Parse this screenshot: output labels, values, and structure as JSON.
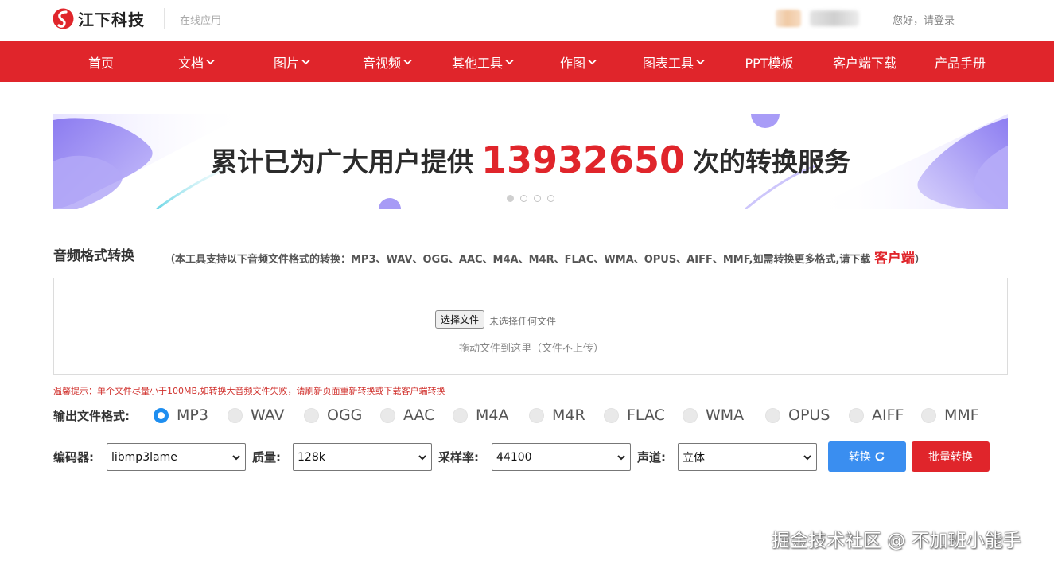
{
  "header": {
    "brand": "江下科技",
    "subtitle": "在线应用",
    "login": "您好，请登录"
  },
  "nav": {
    "items": [
      {
        "label": "首页",
        "dropdown": false
      },
      {
        "label": "文档",
        "dropdown": true
      },
      {
        "label": "图片",
        "dropdown": true
      },
      {
        "label": "音视频",
        "dropdown": true
      },
      {
        "label": "其他工具",
        "dropdown": true
      },
      {
        "label": "作图",
        "dropdown": true
      },
      {
        "label": "图表工具",
        "dropdown": true
      },
      {
        "label": "PPT模板",
        "dropdown": false
      },
      {
        "label": "客户端下载",
        "dropdown": false
      },
      {
        "label": "产品手册",
        "dropdown": false
      }
    ]
  },
  "banner": {
    "prefix": "累计已为广大用户提供",
    "count": "13932650",
    "suffix": "次的转换服务",
    "slides": 4,
    "active_slide": 1
  },
  "section": {
    "title": "音频格式转换",
    "note_prefix": "（本工具支持以下音频文件格式的转换：MP3、WAV、OGG、AAC、M4A、M4R、FLAC、WMA、OPUS、AIFF、MMF,如需转换更多格式,请下载",
    "client_link": "客户端",
    "note_suffix": "）"
  },
  "upload": {
    "button": "选择文件",
    "no_file": "未选择任何文件",
    "drop_hint": "拖动文件到这里（文件不上传）"
  },
  "tip": "温馨提示：单个文件尽量小于100MB,如转换大音频文件失败，请刷新页面重新转换或下载客户端转换",
  "output": {
    "label": "输出文件格式:",
    "formats": [
      "MP3",
      "WAV",
      "OGG",
      "AAC",
      "M4A",
      "M4R",
      "FLAC",
      "WMA",
      "OPUS",
      "AIFF",
      "MMF"
    ],
    "selected": "MP3"
  },
  "options": {
    "encoder_label": "编码器:",
    "encoder_value": "libmp3lame",
    "quality_label": "质量:",
    "quality_value": "128k",
    "samplerate_label": "采样率:",
    "samplerate_value": "44100",
    "channel_label": "声道:",
    "channel_value": "立体"
  },
  "buttons": {
    "convert": "转换",
    "batch": "批量转换"
  },
  "watermark": "掘金技术社区 @ 不加班小能手",
  "colors": {
    "brand_red": "#e0252b",
    "button_blue": "#3a8ef0",
    "radio_blue": "#1e8ef0"
  }
}
